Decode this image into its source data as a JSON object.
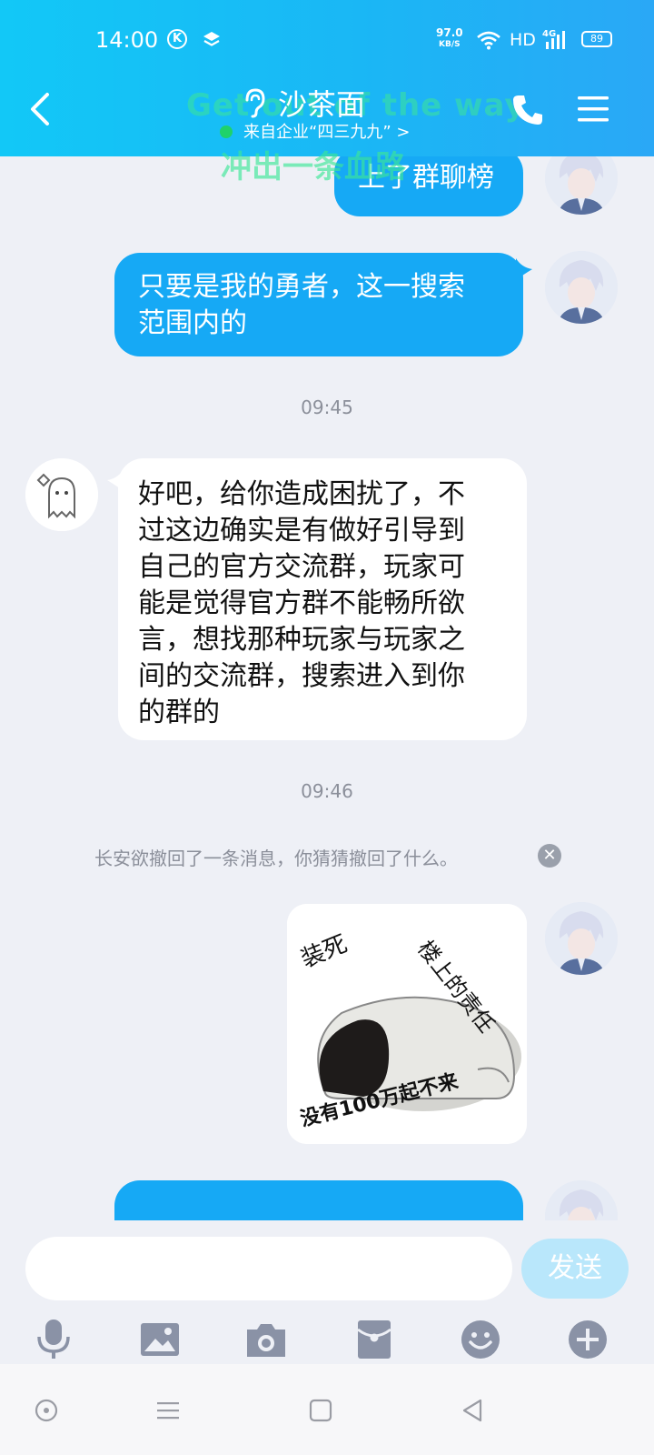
{
  "status_bar": {
    "time": "14:00",
    "k_icon_letter": "K",
    "net_speed_value": "97.0",
    "net_speed_unit": "KB/S",
    "hd_label": "HD",
    "signal_label": "4G",
    "battery": "89"
  },
  "header": {
    "title": "沙茶面",
    "subtitle": "来自企业“四三九九” >",
    "overlay_line1": "Get out of the way",
    "overlay_line2": "冲出一条血路"
  },
  "messages": {
    "m1": "上了群聊榜",
    "m2_line1": "只要是我的勇者，这一搜索",
    "m2_line2": "范围内的",
    "time1": "09:45",
    "m3_lines": [
      "好吧，给你造成困扰了，不",
      "过这边确实是有做好引导到",
      "自己的官方交流群，玩家可",
      "能是觉得官方群不能畅所欲",
      "言，想找那种玩家与玩家之",
      "间的交流群，搜索进入到你",
      "的群的"
    ],
    "time2": "09:46",
    "recall_note": "长安欲撤回了一条消息，你猜猜撤回了什么。",
    "sticker": {
      "text_left": "装死",
      "text_right": "楼上的责任",
      "text_bottom": "没有100万起不来"
    }
  },
  "input": {
    "placeholder": "",
    "value": "",
    "send_label": "发送"
  },
  "toolbar_icons": [
    "microphone-icon",
    "image-icon",
    "camera-icon",
    "red-packet-icon",
    "emoji-icon",
    "plus-icon"
  ],
  "nav_icons": [
    "assistant-icon",
    "menu-icon",
    "home-icon",
    "back-icon"
  ],
  "colors": {
    "header_start": "#12c8f7",
    "header_end": "#2aa8f6",
    "bubble_blue": "#16a9f5",
    "background": "#eef0f6",
    "send_disabled": "#b9e7fb",
    "overlay_text": "#3ce696"
  }
}
